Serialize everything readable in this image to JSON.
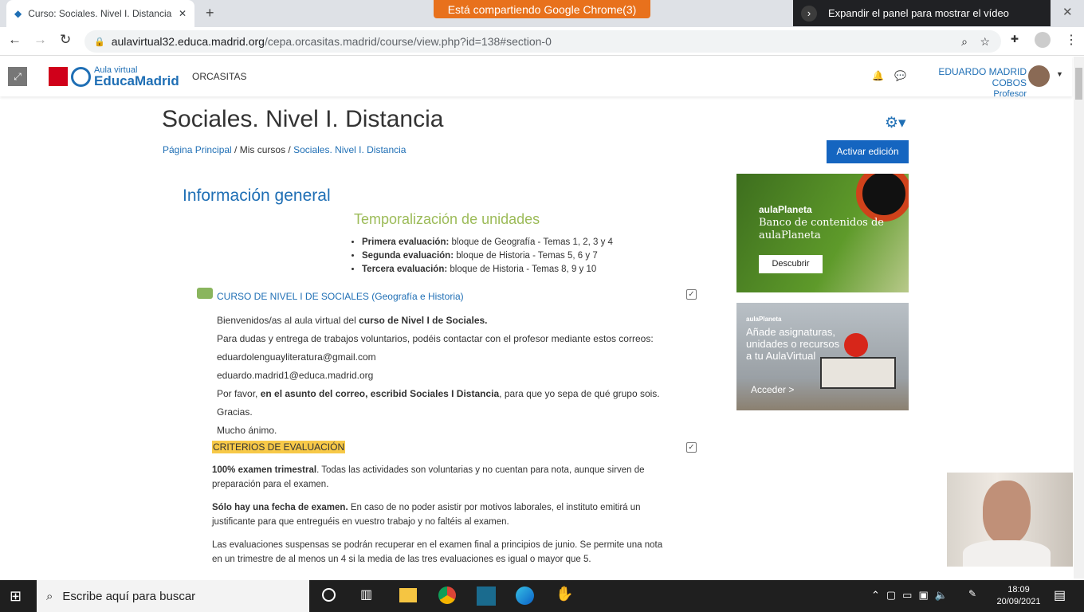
{
  "browser": {
    "tab_title": "Curso: Sociales. Nivel I. Distancia",
    "sharing_banner": "Está compartiendo Google Chrome(3)",
    "expand_panel": "Expandir el panel para mostrar el vídeo",
    "url_host": "aulavirtual32.educa.madrid.org",
    "url_path": "/cepa.orcasitas.madrid/course/view.php?id=138#section-0"
  },
  "header": {
    "logo_small": "Aula virtual",
    "logo_big": "EducaMadrid",
    "site": "ORCASITAS",
    "user_name": "EDUARDO MADRID COBOS",
    "user_role": "Profesor"
  },
  "page": {
    "title": "Sociales. Nivel I. Distancia",
    "breadcrumb": [
      "Página Principal",
      "Mis cursos",
      "Sociales. Nivel I. Distancia"
    ],
    "edit_button": "Activar edición"
  },
  "general": {
    "heading": "Información general",
    "subheading": "Temporalización de unidades",
    "items": [
      {
        "b": "Primera evaluación:",
        "t": " bloque de Geografía - Temas 1, 2, 3 y 4"
      },
      {
        "b": "Segunda evaluación:",
        "t": " bloque de Historia - Temas 5, 6 y 7"
      },
      {
        "b": "Tercera evaluación:",
        "t": " bloque de Historia - Temas 8, 9 y 10"
      }
    ],
    "forum_link": "CURSO DE NIVEL I DE SOCIALES (Geografía e Historia)",
    "welcome_a": "Bienvenidos/as al aula virtual del ",
    "welcome_b": "curso de Nivel I de Sociales.",
    "contact": "Para dudas y entrega de trabajos voluntarios, podéis contactar con el profesor mediante estos correos:",
    "email1": "eduardolenguayliteratura@gmail.com",
    "email2": "eduardo.madrid1@educa.madrid.org",
    "subject_a": "Por favor, ",
    "subject_b": "en el asunto del correo, escribid Sociales I Distancia",
    "subject_c": ", para que yo sepa de qué grupo sois. Gracias.",
    "cheer": "Mucho ánimo."
  },
  "criteria": {
    "title": "CRITERIOS DE EVALUACIÓN",
    "p1b": "100% examen trimestral",
    "p1": ". Todas las actividades son voluntarias y no cuentan para nota, aunque sirven de preparación para el examen.",
    "p2b": "Sólo hay una fecha de examen.",
    "p2": " En caso de no poder asistir por motivos laborales, el instituto emitirá un justificante para que entreguéis en vuestro trabajo y no faltéis al examen.",
    "p3": "Las evaluaciones suspensas se podrán recuperar en el examen final a principios de junio. Se permite una nota en un trimestre de al menos un 4 si la media de las tres evaluaciones es igual o mayor que 5."
  },
  "ads": {
    "brand": "aulaPlaneta",
    "ad1_title": "Banco de contenidos de aulaPlaneta",
    "ad1_button": "Descubrir",
    "ad2_title": "Añade asignaturas, unidades o recursos a tu AulaVirtual",
    "ad2_button": "Acceder >"
  },
  "taskbar": {
    "search_placeholder": "Escribe aquí para buscar",
    "time": "18:09",
    "date": "20/09/2021"
  }
}
